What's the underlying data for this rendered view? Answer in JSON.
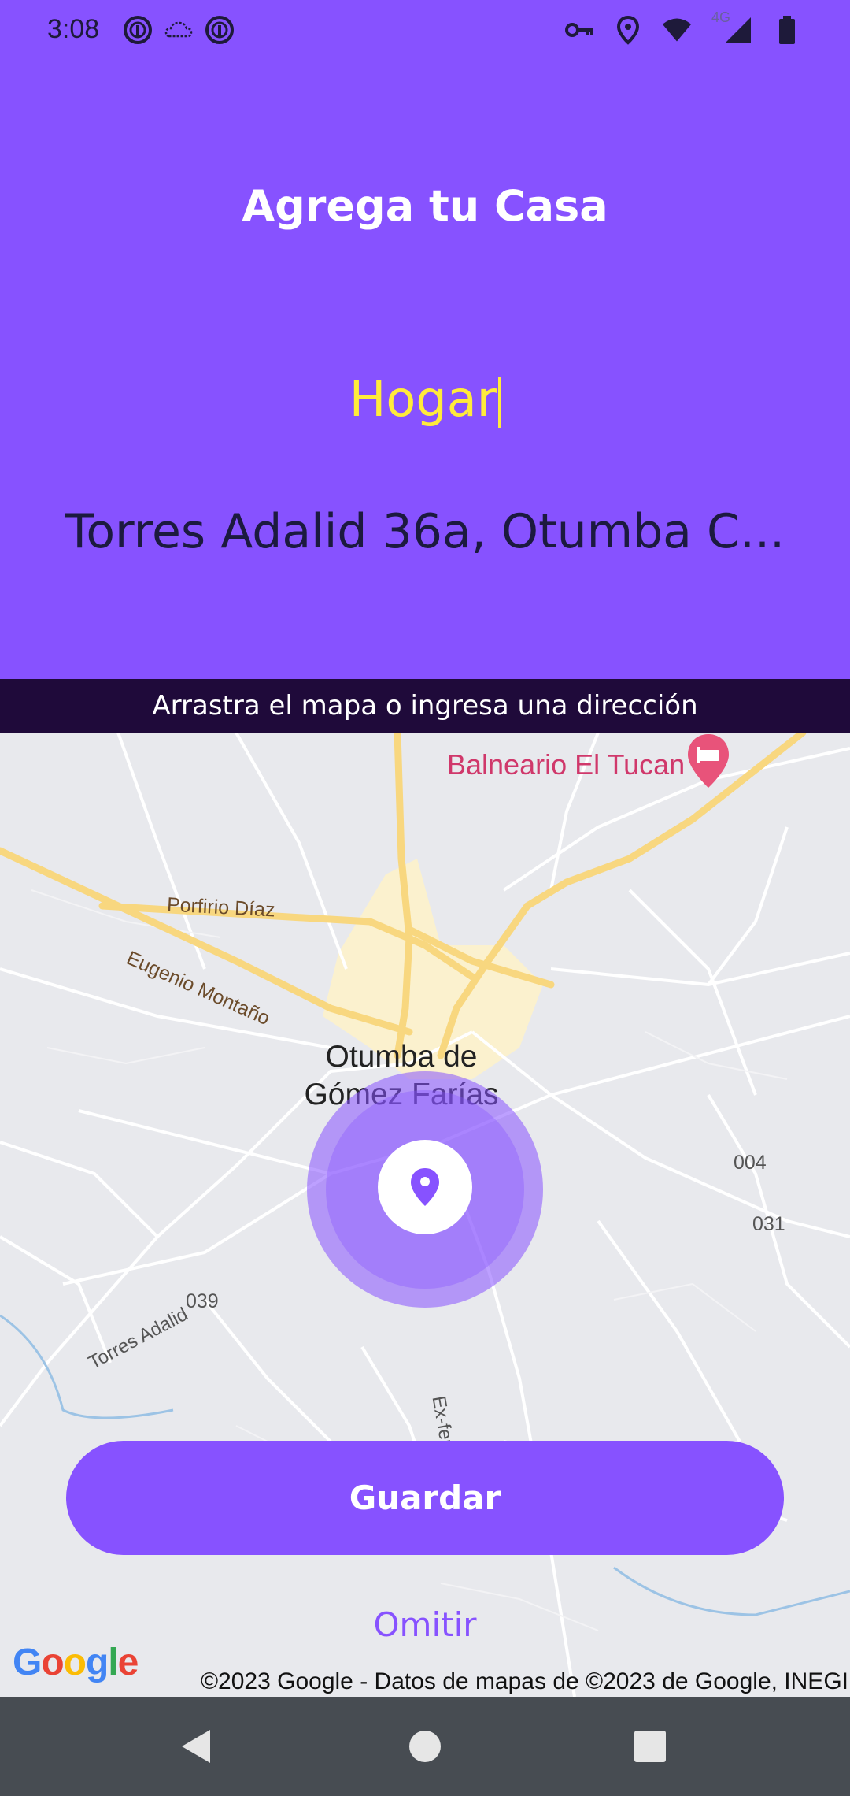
{
  "status_bar": {
    "time": "3:08",
    "notification_icons": [
      "app-notification-icon",
      "cloud-icon",
      "app-notification-icon"
    ],
    "system_icons": [
      "vpn-key-icon",
      "location-icon",
      "wifi-icon",
      "signal-icon",
      "battery-icon"
    ],
    "network_label": "4G"
  },
  "header": {
    "title": "Agrega tu Casa"
  },
  "form": {
    "name_value": "Hogar",
    "address_value": "Torres Adalid 36a, Otumba C..."
  },
  "hint": "Arrastra el mapa o ingresa una dirección",
  "map": {
    "poi": "Balneario El Tucan",
    "roads": [
      "Porfirio Díaz",
      "Eugenio Montaño",
      "Torres Adalid",
      "Ex-fer"
    ],
    "city_line1": "Otumba de",
    "city_line2": "Gómez Farías",
    "numbers": [
      "004",
      "031",
      "039"
    ],
    "google_logo": "Google",
    "attribution": "©2023 Google - Datos de mapas de ©2023 de Google, INEGI"
  },
  "actions": {
    "save_label": "Guardar",
    "skip_label": "Omitir"
  },
  "colors": {
    "primary": "#8752FF",
    "header_bg": "#8752FF",
    "input_text": "#FFEB3B",
    "hint_bg": "#1F0A3A",
    "nav_bg": "#474C52"
  },
  "nav_icons": [
    "back-icon",
    "home-icon",
    "recents-icon"
  ]
}
